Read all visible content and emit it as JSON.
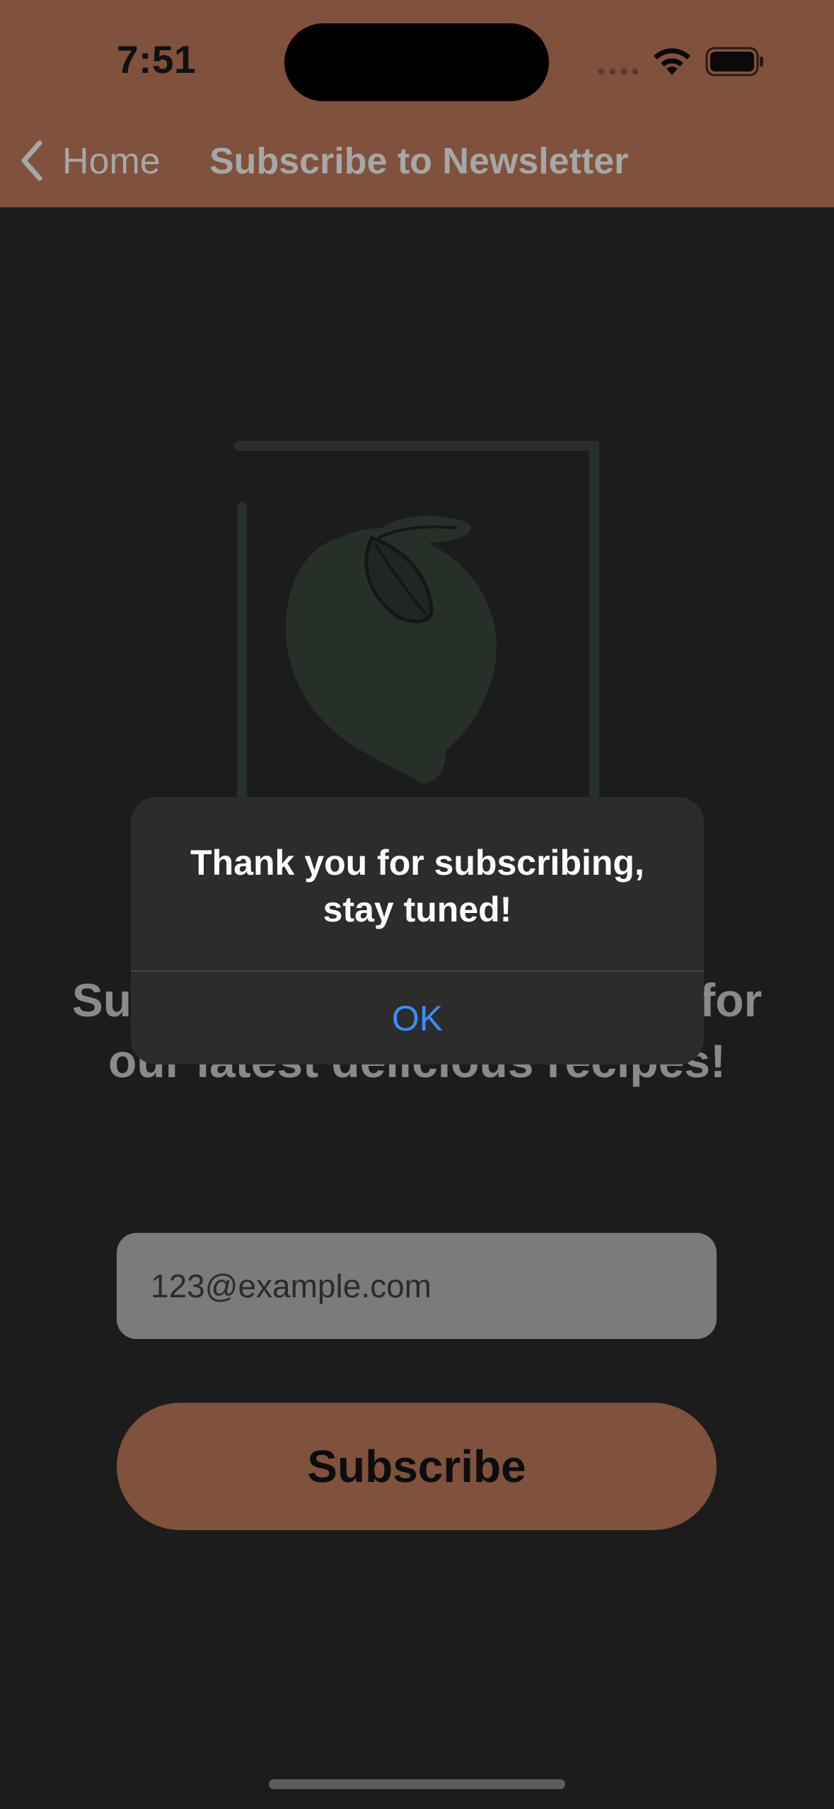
{
  "status_bar": {
    "time": "7:51"
  },
  "nav": {
    "back_label": "Home",
    "title": "Subscribe to Newsletter"
  },
  "main": {
    "headline": "Subscribe to our newsletter for our latest delicious recipes!",
    "email_value": "123@example.com",
    "subscribe_label": "Subscribe"
  },
  "alert": {
    "message": "Thank you for subscribing, stay tuned!",
    "ok_label": "OK"
  },
  "icons": {
    "back": "chevron-left-icon",
    "wifi": "wifi-icon",
    "battery": "battery-icon",
    "signal": "cellular-signal-icon",
    "hero": "lemon-illustration"
  },
  "colors": {
    "header": "#80513d",
    "background": "#1c1c1c",
    "accent_button": "#80513d",
    "alert_action": "#3d8cf6",
    "illustration": "#263029"
  }
}
